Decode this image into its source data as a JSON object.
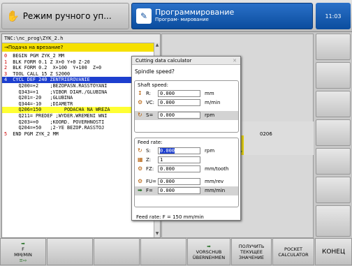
{
  "header": {
    "mode_manual": "Режим ручного уп...",
    "mode_programming": "Программирование",
    "mode_programming_sub": "Програм- мирование",
    "clock": "11:03"
  },
  "program": {
    "path": "TNC:\\nc_prog\\ZYK_2.h",
    "subtitle": "→Подача на врезание?",
    "lines": [
      {
        "num": "0",
        "text": "  BEGIN PGM ZYK_2 MM",
        "style": ""
      },
      {
        "num": "1",
        "text": "  BLK FORM 0.1 Z X+0 Y+0 Z-20",
        "style": ""
      },
      {
        "num": "2",
        "text": "  BLK FORM 0.2  X+100  Y+100  Z+0",
        "style": ""
      },
      {
        "num": "3",
        "text": "  TOOL CALL 15 Z S2000",
        "style": ""
      },
      {
        "num": "4",
        "text": "  CYCL DEF 240 ZENTRIEROVANIE",
        "style": "sel"
      },
      {
        "num": "",
        "text": "     Q200=+2    ;BEZOPASN.RASSTOYANI",
        "style": ""
      },
      {
        "num": "",
        "text": "     Q343=+1    ;VIBOR DIAM./GLUBINA",
        "style": ""
      },
      {
        "num": "",
        "text": "     Q201=-20   ;GLUBINA",
        "style": ""
      },
      {
        "num": "",
        "text": "     Q344=-10   ;DIAMETR",
        "style": ""
      },
      {
        "num": "",
        "text": "     Q206=150        PODACHA NA WREZA",
        "style": "hlt"
      },
      {
        "num": "",
        "text": "     Q211= PREDEF ;WYDER.WREMENI WNI",
        "style": ""
      },
      {
        "num": "",
        "text": "     Q203=+0    ;KOORD. POVERHNOSTI",
        "style": ""
      },
      {
        "num": "",
        "text": "     Q204=+50   ;2-YE BEZOP.RASSTOJ",
        "style": ""
      },
      {
        "num": "5",
        "text": "  END PGM ZYK_2 MM",
        "style": ""
      }
    ]
  },
  "graphic": {
    "label": "0206"
  },
  "dialog": {
    "title": "Cutting data calculator",
    "question": "Spindle speed?",
    "shaft": {
      "title": "Shaft speed:",
      "rows": [
        {
          "label": "R:",
          "value": "0.000",
          "unit": "mm",
          "icon": "radius-icon"
        },
        {
          "label": "VC:",
          "value": "0.000",
          "unit": "m/min",
          "icon": "cutting-speed-icon"
        },
        {
          "label": "S=",
          "value": "0.000",
          "unit": "rpm",
          "icon": "spindle-icon"
        }
      ]
    },
    "feed": {
      "title": "Feed rate:",
      "rows": [
        {
          "label": "S:",
          "value": "0.000",
          "unit": "rpm",
          "icon": "spindle-icon"
        },
        {
          "label": "Z:",
          "value": "1",
          "unit": "",
          "icon": "teeth-icon"
        },
        {
          "label": "FZ:",
          "value": "0.000",
          "unit": "mm/tooth",
          "icon": "feed-per-tooth-icon"
        },
        {
          "label": "FU=",
          "value": "0.000",
          "unit": "mm/rev",
          "icon": "feed-per-rev-icon"
        },
        {
          "label": "F=",
          "value": "0.000",
          "unit": "mm/min",
          "icon": "feed-icon"
        }
      ]
    },
    "footer": "Feed rate: F = 150 mm/min"
  },
  "softkeys": {
    "f_line1": "F",
    "f_line2": "MM/MIN",
    "vorschub1": "VORSCHUB",
    "vorschub2": "ÜBERNEHMEN",
    "actual1": "ПОЛУЧИТЬ",
    "actual2": "ТЕКУЩЕЕ",
    "actual3": "ЗНАЧЕНИЕ",
    "pocket1": "POCKET",
    "pocket2": "CALCULATOR",
    "end": "КОНЕЦ"
  }
}
